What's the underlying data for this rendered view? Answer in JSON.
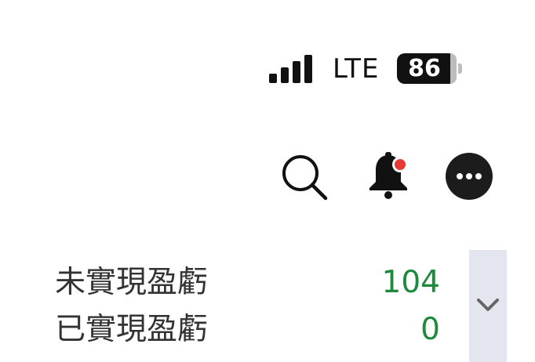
{
  "status_bar": {
    "network": "LTE",
    "battery": "86",
    "signal_bars": 4
  },
  "toolbar": {
    "icons": [
      "search-icon",
      "bell-icon",
      "more-icon"
    ],
    "notification_dot_color": "#e53935"
  },
  "pnl": {
    "unrealized_label": "未實現盈虧",
    "unrealized_value": "104",
    "realized_label": "已實現盈虧",
    "realized_value": "0",
    "value_color": "#1e8a3c"
  },
  "collapse_icon": "chevron-down-icon"
}
